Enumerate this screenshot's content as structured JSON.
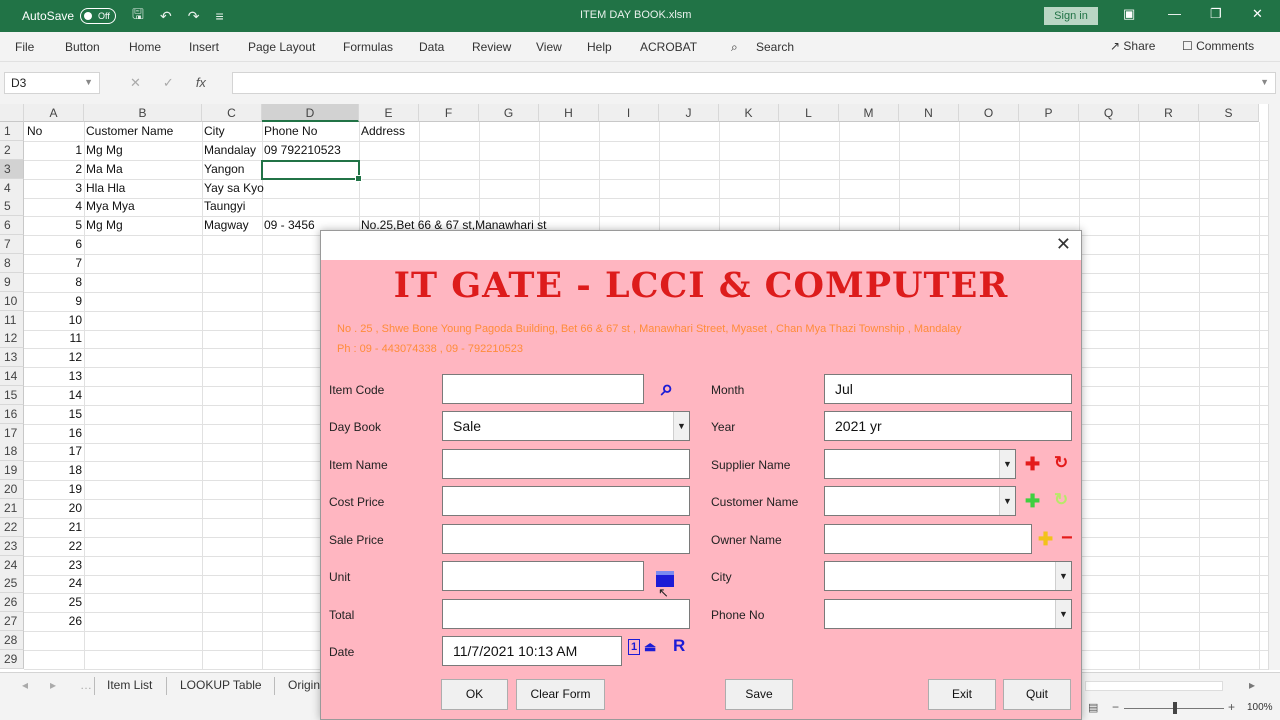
{
  "app": {
    "autosave_label": "AutoSave",
    "autosave_state": "Off",
    "file_title": "ITEM DAY BOOK.xlsm",
    "signin_label": "Sign in"
  },
  "ribbon_tabs": [
    "File",
    "Button",
    "Home",
    "Insert",
    "Page Layout",
    "Formulas",
    "Data",
    "Review",
    "View",
    "Help",
    "ACROBAT"
  ],
  "search_label": "Search",
  "share_label": "Share",
  "comments_label": "Comments",
  "formula_bar": {
    "name_box": "D3",
    "fx": "fx",
    "content": ""
  },
  "columns": [
    "A",
    "B",
    "C",
    "D",
    "E",
    "F",
    "G",
    "H",
    "I",
    "J",
    "K",
    "L",
    "M",
    "N",
    "O",
    "P",
    "Q",
    "R",
    "S"
  ],
  "rows": [
    "1",
    "2",
    "3",
    "4",
    "5",
    "6",
    "7",
    "8",
    "9",
    "10",
    "11",
    "12",
    "13",
    "14",
    "15",
    "16",
    "17",
    "18",
    "19",
    "20",
    "21",
    "22",
    "23",
    "24",
    "25",
    "26",
    "27",
    "28",
    "29"
  ],
  "sheet": {
    "headers": {
      "A": "No",
      "B": "Customer Name",
      "C": "City",
      "D": "Phone No",
      "E": "Address"
    },
    "records": [
      {
        "no": "1",
        "name": "Mg Mg",
        "city": "Mandalay",
        "phone": "09 792210523",
        "address": ""
      },
      {
        "no": "2",
        "name": "Ma Ma",
        "city": "Yangon",
        "phone": "",
        "address": ""
      },
      {
        "no": "3",
        "name": "Hla Hla",
        "city": "Yay sa Kyo",
        "phone": "",
        "address": ""
      },
      {
        "no": "4",
        "name": "Mya Mya",
        "city": "Taungyi",
        "phone": "",
        "address": ""
      },
      {
        "no": "5",
        "name": "Mg Mg",
        "city": "Magway",
        "phone": "09 - 3456",
        "address": "No.25,Bet 66 & 67 st,Manawhari st"
      }
    ],
    "numbers_only": [
      "6",
      "7",
      "8",
      "9",
      "10",
      "11",
      "12",
      "13",
      "14",
      "15",
      "16",
      "17",
      "18",
      "19",
      "20",
      "21",
      "22",
      "23",
      "24",
      "25",
      "26"
    ]
  },
  "sheet_tabs": [
    "Item List",
    "LOOKUP Table",
    "Origin"
  ],
  "zoom": "100%",
  "dialog": {
    "title_banner": "IT GATE - LCCI & COMPUTER",
    "address_line1": "No . 25 , Shwe Bone Young Pagoda Building, Bet 66 & 67 st , Manawhari Street, Myaset , Chan Mya Thazi Township , Mandalay",
    "address_line2": "Ph : 09 - 443074338 , 09 - 792210523",
    "left_fields": [
      {
        "label": "Item Code",
        "value": ""
      },
      {
        "label": "Day Book",
        "value": "Sale"
      },
      {
        "label": "Item Name",
        "value": ""
      },
      {
        "label": "Cost Price",
        "value": ""
      },
      {
        "label": "Sale Price",
        "value": ""
      },
      {
        "label": "Unit",
        "value": ""
      },
      {
        "label": "Total",
        "value": ""
      },
      {
        "label": "Date",
        "value": "11/7/2021 10:13 AM"
      }
    ],
    "right_fields": [
      {
        "label": "Month",
        "value": "Jul"
      },
      {
        "label": "Year",
        "value": "2021 yr"
      },
      {
        "label": "Supplier Name",
        "value": ""
      },
      {
        "label": "Customer Name",
        "value": ""
      },
      {
        "label": "Owner Name",
        "value": ""
      },
      {
        "label": "City",
        "value": ""
      },
      {
        "label": "Phone No",
        "value": ""
      }
    ],
    "date_icons": {
      "one": "1",
      "r": "R"
    },
    "buttons": {
      "ok": "OK",
      "clear": "Clear Form",
      "save": "Save",
      "exit": "Exit",
      "quit": "Quit"
    },
    "colors": {
      "background": "#ffb6c1",
      "banner": "#dd1c1c",
      "address": "#ff8c3a",
      "add_icon": "#e41b1b",
      "green_icon": "#3fcf3f",
      "blue_icon": "#1c1cd6",
      "yellow_icon": "#f2c21a"
    }
  }
}
